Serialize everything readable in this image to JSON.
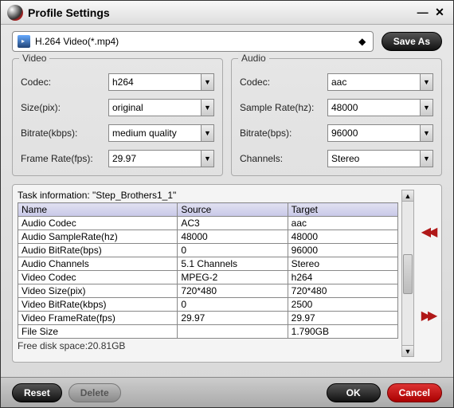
{
  "window": {
    "title": "Profile Settings"
  },
  "topbar": {
    "profile": "H.264 Video(*.mp4)",
    "save_as": "Save As"
  },
  "video": {
    "legend": "Video",
    "codec_label": "Codec:",
    "codec_value": "h264",
    "size_label": "Size(pix):",
    "size_value": "original",
    "bitrate_label": "Bitrate(kbps):",
    "bitrate_value": "medium quality",
    "framerate_label": "Frame Rate(fps):",
    "framerate_value": "29.97"
  },
  "audio": {
    "legend": "Audio",
    "codec_label": "Codec:",
    "codec_value": "aac",
    "samplerate_label": "Sample Rate(hz):",
    "samplerate_value": "48000",
    "bitrate_label": "Bitrate(bps):",
    "bitrate_value": "96000",
    "channels_label": "Channels:",
    "channels_value": "Stereo"
  },
  "task": {
    "info_label": "Task information: \"Step_Brothers1_1\"",
    "headers": {
      "name": "Name",
      "source": "Source",
      "target": "Target"
    },
    "rows": [
      {
        "name": "Audio Codec",
        "source": "AC3",
        "target": "aac"
      },
      {
        "name": "Audio SampleRate(hz)",
        "source": "48000",
        "target": "48000"
      },
      {
        "name": "Audio BitRate(bps)",
        "source": "0",
        "target": "96000"
      },
      {
        "name": "Audio Channels",
        "source": "5.1 Channels",
        "target": "Stereo"
      },
      {
        "name": "Video Codec",
        "source": "MPEG-2",
        "target": "h264"
      },
      {
        "name": "Video Size(pix)",
        "source": "720*480",
        "target": "720*480"
      },
      {
        "name": "Video BitRate(kbps)",
        "source": "0",
        "target": "2500"
      },
      {
        "name": "Video FrameRate(fps)",
        "source": "29.97",
        "target": "29.97"
      },
      {
        "name": "File Size",
        "source": "",
        "target": "1.790GB"
      }
    ],
    "free_disk": "Free disk space:20.81GB"
  },
  "buttons": {
    "reset": "Reset",
    "delete": "Delete",
    "ok": "OK",
    "cancel": "Cancel"
  }
}
